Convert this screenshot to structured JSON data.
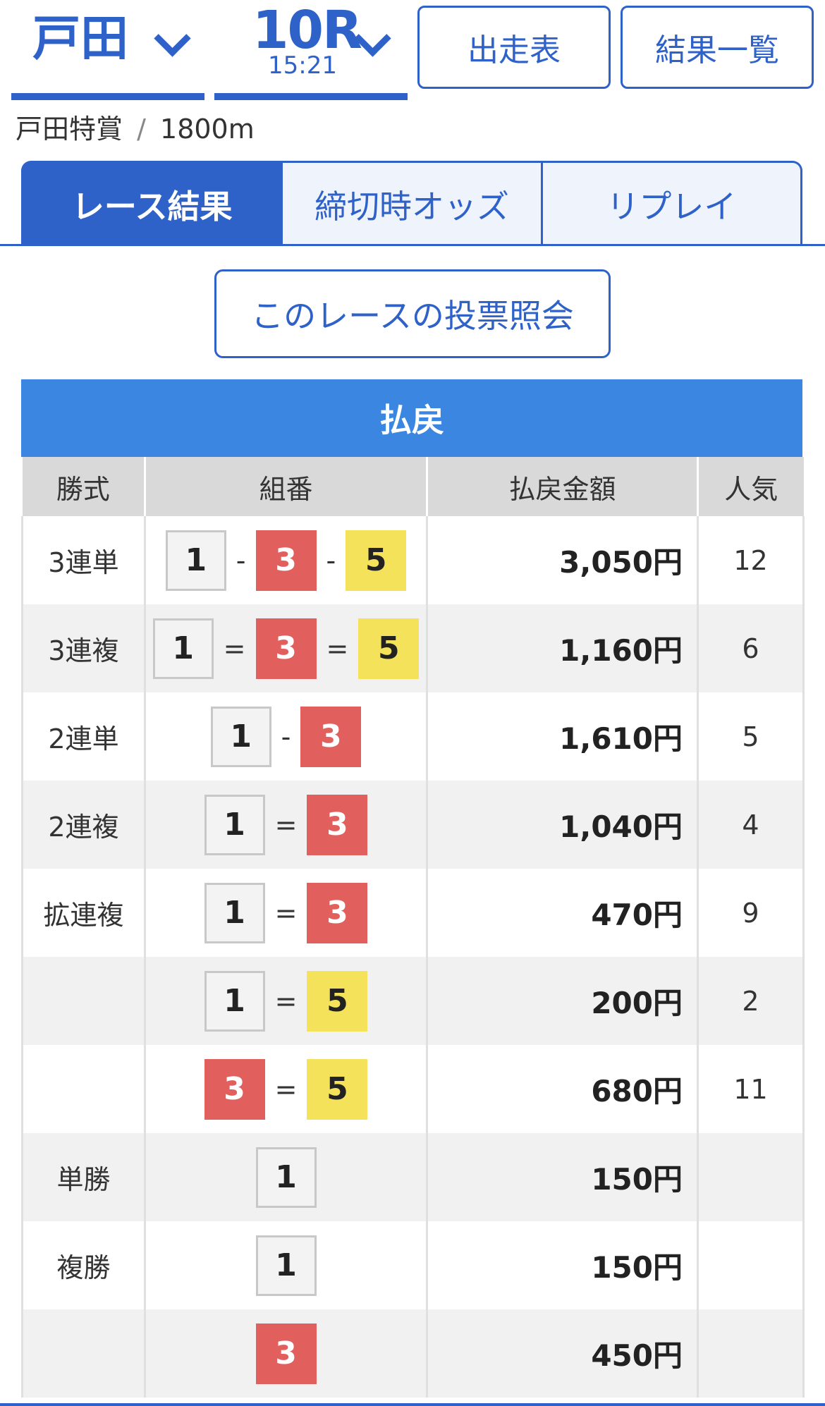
{
  "header": {
    "venue": "戸田",
    "race": "10R",
    "time": "15:21",
    "entry_button": "出走表",
    "results_button": "結果一覧"
  },
  "subtitle": {
    "race_name": "戸田特賞",
    "separator": "/",
    "distance": "1800m"
  },
  "tabs": [
    {
      "label": "レース結果",
      "active": true
    },
    {
      "label": "締切時オッズ",
      "active": false
    },
    {
      "label": "リプレイ",
      "active": false
    }
  ],
  "inquiry_button": "このレースの投票照会",
  "payout": {
    "title": "払戻",
    "columns": [
      "勝式",
      "組番",
      "払戻金額",
      "人気"
    ],
    "rows": [
      {
        "type": "3連単",
        "boxes": [
          "1",
          "3",
          "5"
        ],
        "op": "-",
        "amount": "3,050円",
        "pop": "12"
      },
      {
        "type": "3連複",
        "boxes": [
          "1",
          "3",
          "5"
        ],
        "op": "=",
        "amount": "1,160円",
        "pop": "6"
      },
      {
        "type": "2連単",
        "boxes": [
          "1",
          "3"
        ],
        "op": "-",
        "amount": "1,610円",
        "pop": "5"
      },
      {
        "type": "2連複",
        "boxes": [
          "1",
          "3"
        ],
        "op": "=",
        "amount": "1,040円",
        "pop": "4"
      },
      {
        "type": "拡連複",
        "boxes": [
          "1",
          "3"
        ],
        "op": "=",
        "amount": "470円",
        "pop": "9"
      },
      {
        "type": "",
        "boxes": [
          "1",
          "5"
        ],
        "op": "=",
        "amount": "200円",
        "pop": "2"
      },
      {
        "type": "",
        "boxes": [
          "3",
          "5"
        ],
        "op": "=",
        "amount": "680円",
        "pop": "11"
      },
      {
        "type": "単勝",
        "boxes": [
          "1"
        ],
        "op": "",
        "amount": "150円",
        "pop": ""
      },
      {
        "type": "複勝",
        "boxes": [
          "1"
        ],
        "op": "",
        "amount": "150円",
        "pop": ""
      },
      {
        "type": "",
        "boxes": [
          "3"
        ],
        "op": "",
        "amount": "450円",
        "pop": ""
      }
    ]
  },
  "colors": {
    "accent": "#2f62c8",
    "payout_header": "#3a86e0",
    "boat_1": "#f3f3f3",
    "boat_3": "#e1605e",
    "boat_5": "#f4e25a"
  }
}
